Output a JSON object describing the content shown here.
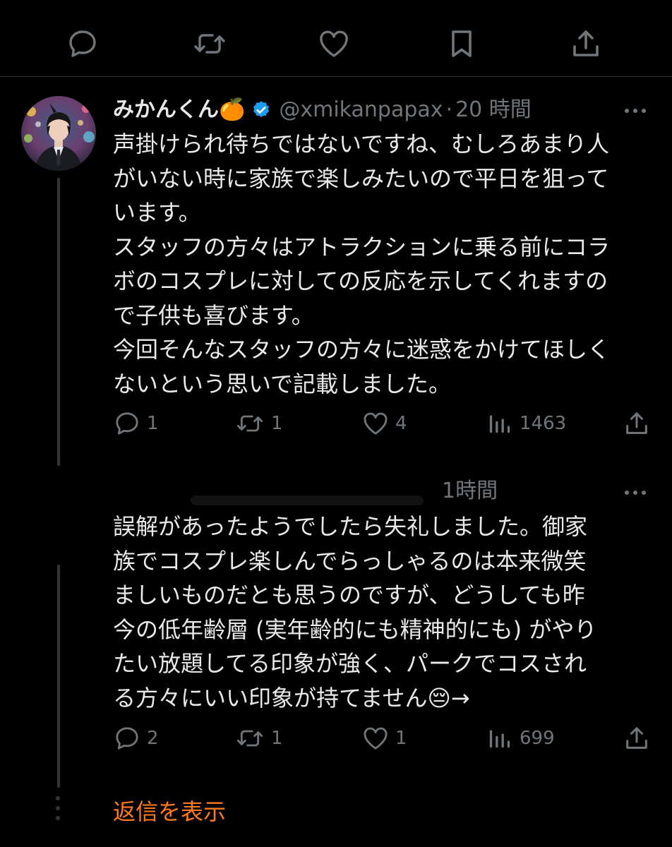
{
  "top_actions": {
    "reply_icon": "reply-icon",
    "retweet_icon": "retweet-icon",
    "like_icon": "like-icon",
    "bookmark_icon": "bookmark-icon",
    "share_icon": "share-icon"
  },
  "tweet1": {
    "name": "みかんくん🍊",
    "verified_icon": "verified-badge-icon",
    "handle": "@xmikanpapax",
    "separator": "·",
    "time": "20 時間",
    "lines": [
      "声掛けられ待ちではないですね、むしろあまり人",
      "がいない時に家族で楽しみたいので平日を狙って",
      "います。",
      "スタッフの方々はアトラクションに乗る前にコラ",
      "ボのコスプレに対しての反応を示してくれますの",
      "で子供も喜びます。",
      "今回そんなスタッフの方々に迷惑をかけてほしく",
      "ないという思いで記載しました。"
    ],
    "replies": "1",
    "retweets": "1",
    "likes": "4",
    "views": "1463"
  },
  "tweet2": {
    "time": "1時間",
    "lines": [
      "誤解があったようでしたら失礼しました。御家",
      "族でコスプレ楽しんでらっしゃるのは本来微笑",
      "ましいものだとも思うのですが、どうしても昨",
      "今の低年齢層 (実年齢的にも精神的にも) がやり",
      "たい放題してる印象が強く、パークでコスされ",
      "る方々にいい印象が持てません😔→"
    ],
    "replies": "2",
    "retweets": "1",
    "likes": "1",
    "views": "699"
  },
  "show_replies": "返信を表示",
  "colors": {
    "background": "#000000",
    "text": "#e7e9ea",
    "muted": "#71767b",
    "verified": "#1d9bf0",
    "accent_orange": "#ff7a1a"
  }
}
